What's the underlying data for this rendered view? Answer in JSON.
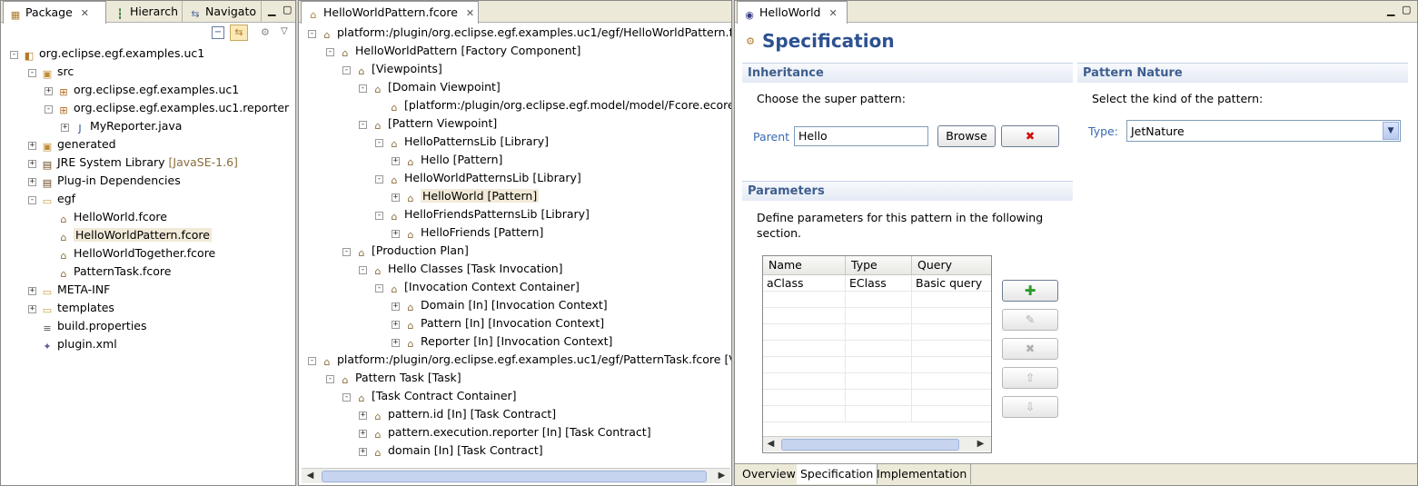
{
  "package_panel": {
    "tabs": [
      {
        "label": "Package",
        "icon": "package-icon"
      },
      {
        "label": "Hierarch",
        "icon": "hierarchy-icon"
      },
      {
        "label": "Navigato",
        "icon": "navigator-icon"
      }
    ],
    "tree": [
      {
        "label": "org.eclipse.egf.examples.uc1",
        "icon": "project-icon",
        "exp": "−"
      },
      {
        "label": "src",
        "icon": "source-folder-icon",
        "exp": "−"
      },
      {
        "label": "org.eclipse.egf.examples.uc1",
        "icon": "java-package-icon",
        "exp": "+"
      },
      {
        "label": "org.eclipse.egf.examples.uc1.reporter",
        "icon": "java-package-icon",
        "exp": "−"
      },
      {
        "label": "MyReporter.java",
        "icon": "java-file-icon",
        "exp": "+"
      },
      {
        "label": "generated",
        "icon": "source-folder-icon",
        "exp": "+"
      },
      {
        "label": "JRE System Library",
        "suffix": "[JavaSE-1.6]",
        "icon": "library-icon",
        "exp": "+"
      },
      {
        "label": "Plug-in Dependencies",
        "icon": "library-icon",
        "exp": "+"
      },
      {
        "label": "egf",
        "icon": "folder-icon",
        "exp": "−"
      },
      {
        "label": "HelloWorld.fcore",
        "icon": "fcore-file-icon",
        "exp": ""
      },
      {
        "label": "HelloWorldPattern.fcore",
        "icon": "fcore-file-icon",
        "exp": "",
        "selected": true
      },
      {
        "label": "HelloWorldTogether.fcore",
        "icon": "fcore-file-icon",
        "exp": ""
      },
      {
        "label": "PatternTask.fcore",
        "icon": "fcore-file-icon",
        "exp": ""
      },
      {
        "label": "META-INF",
        "icon": "folder-icon",
        "exp": "+"
      },
      {
        "label": "templates",
        "icon": "folder-icon",
        "exp": "+"
      },
      {
        "label": "build.properties",
        "icon": "properties-file-icon",
        "exp": ""
      },
      {
        "label": "plugin.xml",
        "icon": "plugin-xml-icon",
        "exp": ""
      }
    ]
  },
  "fcore_panel": {
    "tab_label": "HelloWorldPattern.fcore",
    "tree": [
      {
        "label": "platform:/plugin/org.eclipse.egf.examples.uc1/egf/HelloWorldPattern.fc",
        "exp": "−"
      },
      {
        "label": "HelloWorldPattern [Factory Component]",
        "exp": "−"
      },
      {
        "label": "[Viewpoints]",
        "exp": "−"
      },
      {
        "label": "[Domain Viewpoint]",
        "exp": "−"
      },
      {
        "label": "[platform:/plugin/org.eclipse.egf.model/model/Fcore.ecore",
        "exp": ""
      },
      {
        "label": "[Pattern Viewpoint]",
        "exp": "−"
      },
      {
        "label": "HelloPatternsLib [Library]",
        "exp": "−"
      },
      {
        "label": "Hello [Pattern]",
        "exp": "+"
      },
      {
        "label": "HelloWorldPatternsLib [Library]",
        "exp": "−"
      },
      {
        "label": "HelloWorld [Pattern]",
        "exp": "+",
        "selected": true
      },
      {
        "label": "HelloFriendsPatternsLib [Library]",
        "exp": "−"
      },
      {
        "label": "HelloFriends [Pattern]",
        "exp": "+"
      },
      {
        "label": "[Production Plan]",
        "exp": "−"
      },
      {
        "label": "Hello Classes [Task Invocation]",
        "exp": "−"
      },
      {
        "label": "[Invocation Context Container]",
        "exp": "−"
      },
      {
        "label": "Domain [In] [Invocation Context]",
        "exp": "+"
      },
      {
        "label": "Pattern [In] [Invocation Context]",
        "exp": "+"
      },
      {
        "label": "Reporter [In] [Invocation Context]",
        "exp": "+"
      },
      {
        "label": "platform:/plugin/org.eclipse.egf.examples.uc1/egf/PatternTask.fcore [V",
        "exp": "−"
      },
      {
        "label": "Pattern Task [Task]",
        "exp": "−"
      },
      {
        "label": "[Task Contract Container]",
        "exp": "−"
      },
      {
        "label": "pattern.id [In] [Task Contract]",
        "exp": "+"
      },
      {
        "label": "pattern.execution.reporter [In] [Task Contract]",
        "exp": "+"
      },
      {
        "label": "domain [In] [Task Contract]",
        "exp": "+"
      }
    ]
  },
  "editor": {
    "tab_label": "HelloWorld",
    "title": "Specification",
    "inheritance": {
      "header": "Inheritance",
      "description": "Choose the super pattern:",
      "parent_label": "Parent",
      "parent_value": "Hello",
      "browse_label": "Browse",
      "clear_glyph": "✖"
    },
    "pattern_nature": {
      "header": "Pattern Nature",
      "description": "Select the kind of the pattern:",
      "type_label": "Type:",
      "type_value": "JetNature"
    },
    "parameters": {
      "header": "Parameters",
      "description": "Define parameters for this pattern in the following section.",
      "columns": [
        "Name",
        "Type",
        "Query"
      ],
      "rows": [
        [
          "aClass",
          "EClass",
          "Basic query"
        ]
      ],
      "buttons": [
        "add",
        "edit",
        "remove",
        "up",
        "down"
      ]
    },
    "bottom_tabs": [
      "Overview",
      "Specification",
      "Implementation"
    ]
  }
}
